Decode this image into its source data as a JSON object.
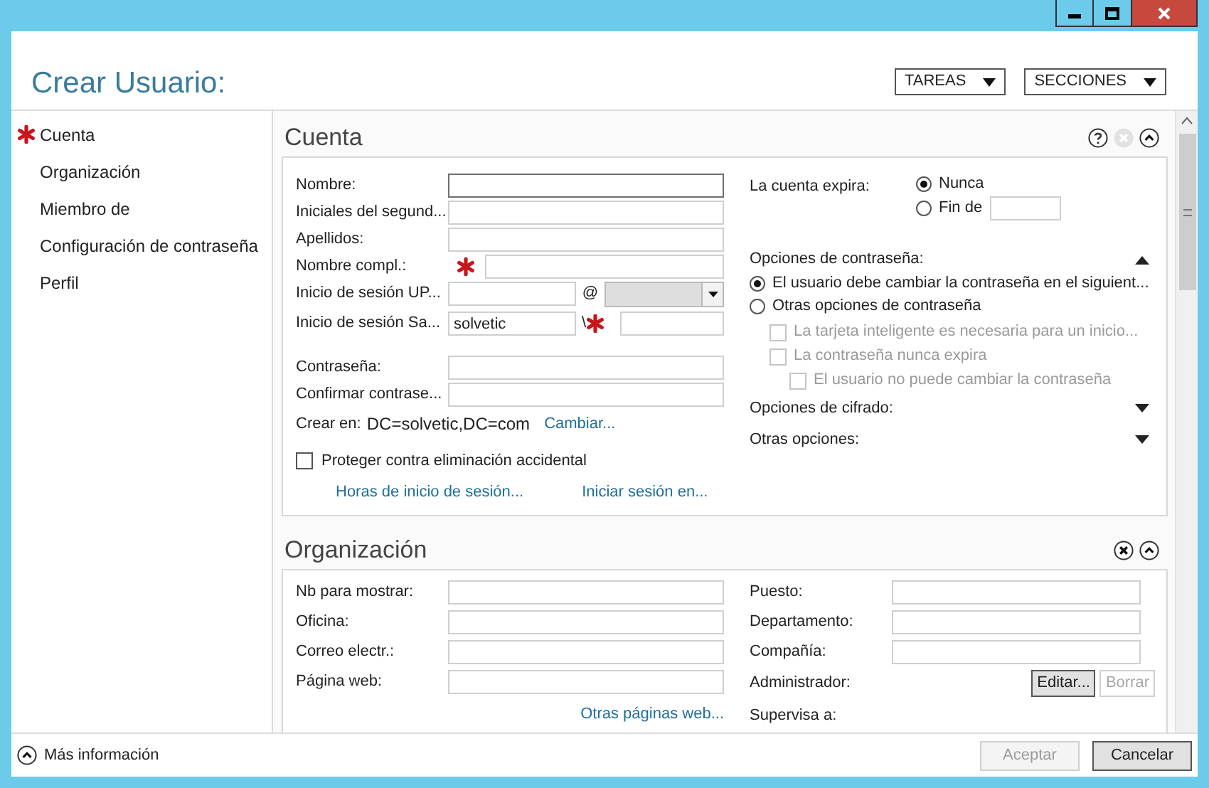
{
  "window": {
    "title": "Crear Usuario:"
  },
  "header_menus": [
    {
      "label": "TAREAS"
    },
    {
      "label": "SECCIONES"
    }
  ],
  "sidebar": {
    "items": [
      {
        "label": "Cuenta",
        "required": true
      },
      {
        "label": "Organización",
        "required": false
      },
      {
        "label": "Miembro de",
        "required": false
      },
      {
        "label": "Configuración de contraseña",
        "required": false
      },
      {
        "label": "Perfil",
        "required": false
      }
    ]
  },
  "account": {
    "title": "Cuenta",
    "help": true,
    "close_enabled": false,
    "fields": [
      {
        "label": "Nombre:",
        "kind": "text",
        "focused": true
      },
      {
        "label": "Iniciales del segund...",
        "kind": "text"
      },
      {
        "label": "Apellidos:",
        "kind": "text"
      },
      {
        "label": "Nombre compl.:",
        "kind": "required"
      },
      {
        "label": "Inicio de sesión UP...",
        "kind": "upn",
        "separator": "@"
      },
      {
        "label": "Inicio de sesión Sa...",
        "kind": "sam",
        "value": "solvetic",
        "separator": "\\"
      }
    ],
    "password_fields": [
      {
        "label": "Contraseña:"
      },
      {
        "label": "Confirmar contrase..."
      }
    ],
    "create_in": {
      "label": "Crear en:",
      "value": "DC=solvetic,DC=com",
      "link": "Cambiar..."
    },
    "protect": {
      "label": "Proteger contra eliminación accidental",
      "checked": false
    },
    "links": [
      "Horas de inicio de sesión...",
      "Iniciar sesión en..."
    ],
    "expiry": {
      "label": "La cuenta expira:",
      "options": [
        {
          "label": "Nunca",
          "selected": true
        },
        {
          "label": "Fin de",
          "selected": false
        }
      ]
    },
    "password_options": {
      "title": "Opciones de contraseña:",
      "expanded": true,
      "options": [
        {
          "label": "El usuario debe cambiar la contraseña en el siguient...",
          "selected": true
        },
        {
          "label": "Otras opciones de contraseña",
          "selected": false
        }
      ],
      "checkboxes": [
        {
          "label": "La tarjeta inteligente es necesaria para un inicio...",
          "checked": false,
          "disabled": true
        },
        {
          "label": "La contraseña nunca expira",
          "checked": false,
          "disabled": true,
          "children": [
            {
              "label": "El usuario no puede cambiar la contraseña",
              "checked": false,
              "disabled": true
            }
          ]
        }
      ]
    },
    "collapsibles": [
      {
        "title": "Opciones de cifrado:",
        "expanded": false
      },
      {
        "title": "Otras opciones:",
        "expanded": false
      }
    ]
  },
  "organization": {
    "title": "Organización",
    "help": false,
    "close_enabled": true,
    "left_fields": [
      {
        "label": "Nb para mostrar:"
      },
      {
        "label": "Oficina:"
      },
      {
        "label": "Correo electr.:"
      },
      {
        "label": "Página web:"
      }
    ],
    "link": "Otras páginas web...",
    "right_fields": [
      {
        "label": "Puesto:"
      },
      {
        "label": "Departamento:"
      },
      {
        "label": "Compañía:"
      }
    ],
    "manager": {
      "label": "Administrador:",
      "buttons": [
        {
          "label": "Editar...",
          "disabled": false
        },
        {
          "label": "Borrar",
          "disabled": true
        }
      ]
    },
    "supervises": "Supervisa a:"
  },
  "footer": {
    "more_info": "Más información",
    "buttons": [
      {
        "label": "Aceptar",
        "disabled": true
      },
      {
        "label": "Cancelar",
        "disabled": false
      }
    ]
  }
}
